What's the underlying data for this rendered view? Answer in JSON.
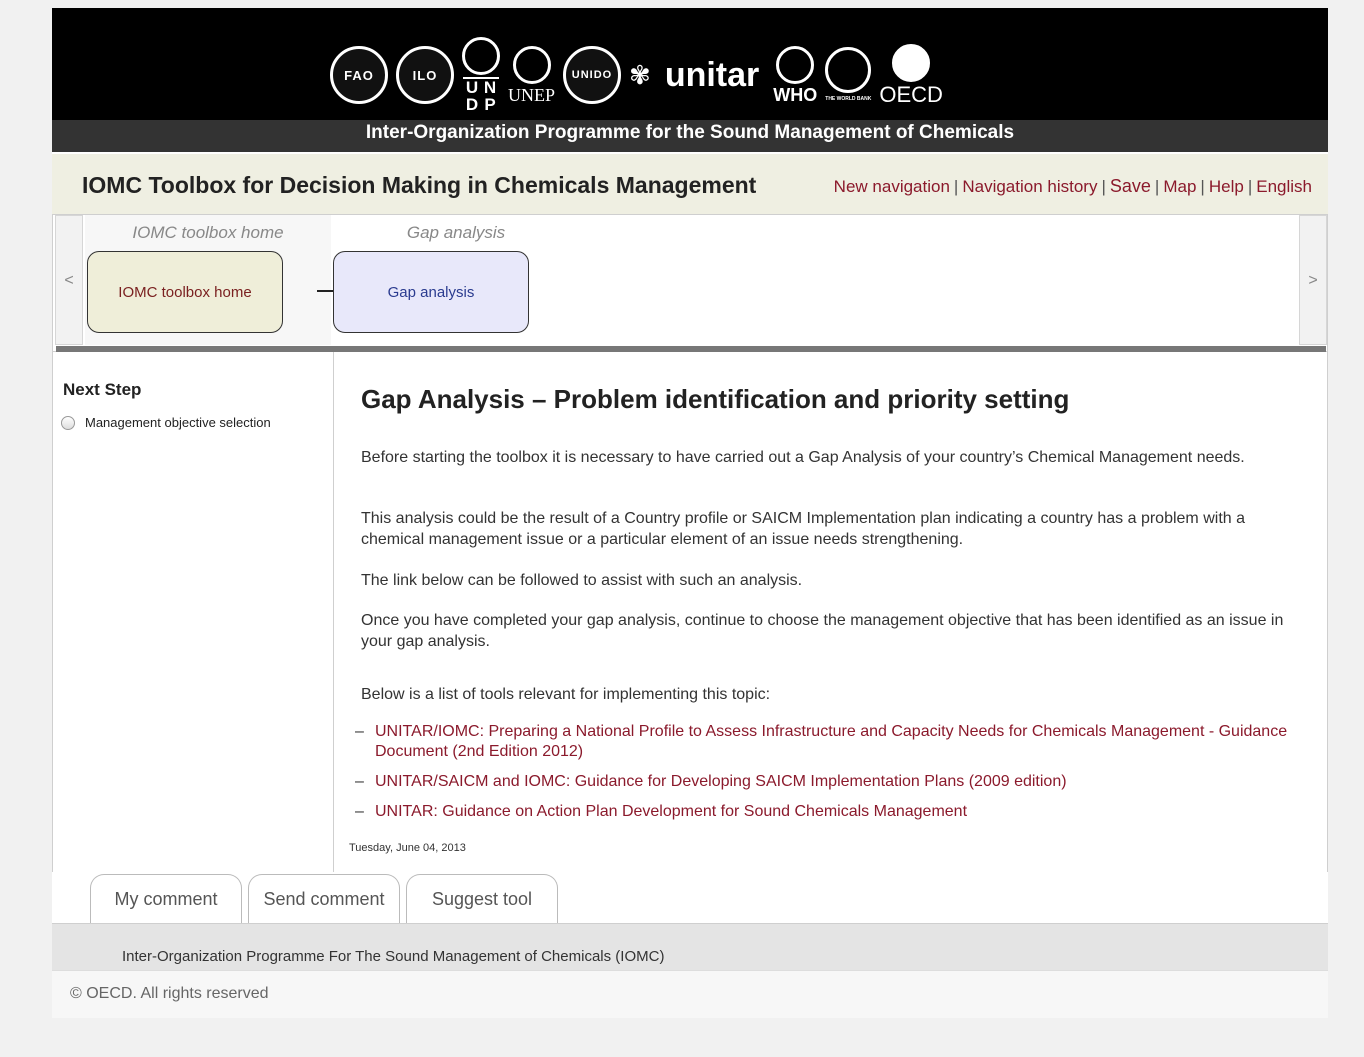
{
  "header": {
    "logos": {
      "fao": "FAO",
      "ilo": "ILO",
      "undp": [
        "U",
        "N",
        "D",
        "P"
      ],
      "unep": "UNEP",
      "unido": "UNIDO",
      "unitar": "unitar",
      "who": "WHO",
      "world_bank": "THE WORLD BANK",
      "oecd": "OECD"
    },
    "organization": "Inter-Organization Programme for the Sound Management of Chemicals"
  },
  "title_bar": {
    "title": "IOMC Toolbox for Decision Making in Chemicals Management",
    "links": {
      "new_navigation": "New navigation",
      "navigation_history": "Navigation history",
      "save": "Save",
      "map": "Map",
      "help": "Help",
      "language": "English"
    },
    "separator": "|"
  },
  "flow": {
    "prev": "<",
    "next": ">",
    "columns": [
      {
        "label": "IOMC toolbox home",
        "node": "IOMC toolbox home"
      },
      {
        "label": "Gap analysis",
        "node": "Gap analysis"
      }
    ]
  },
  "sidebar": {
    "title": "Next Step",
    "items": [
      {
        "label": "Management objective selection"
      }
    ]
  },
  "content": {
    "heading": "Gap Analysis – Problem identification and priority setting",
    "paragraphs": [
      "Before starting the toolbox it is necessary to have carried out a Gap Analysis of your country’s Chemical Management needs.",
      "This analysis could be the result of a Country profile or SAICM Implementation plan indicating a country has a problem with a chemical management issue or a particular element of an issue needs strengthening.",
      "The link below can be followed to assist with such an analysis.",
      "Once you have completed your gap analysis, continue to choose the management objective that has been identified as an issue in your gap analysis.",
      "Below is a list of tools relevant for implementing this topic:"
    ],
    "tools": [
      "UNITAR/IOMC: Preparing a National Profile to Assess Infrastructure and Capacity Needs for Chemicals Management - Guidance Document (2nd Edition 2012)",
      "UNITAR/SAICM and IOMC: Guidance for Developing SAICM Implementation Plans (2009 edition)",
      "UNITAR: Guidance on Action Plan Development for Sound Chemicals Management"
    ],
    "bullet": "–",
    "date": "Tuesday, June 04, 2013"
  },
  "tabs": [
    "My comment",
    "Send comment",
    "Suggest tool"
  ],
  "footer": {
    "organization": "Inter-Organization Programme For The Sound Management of Chemicals (IOMC)",
    "copyright": "© OECD. All rights reserved"
  },
  "colors": {
    "link": "#8b1a2c",
    "header_bg": "#000000",
    "title_bar_bg": "#efefe2",
    "node_home_bg": "#efeed9",
    "node_gap_bg": "#e8e8fa"
  }
}
